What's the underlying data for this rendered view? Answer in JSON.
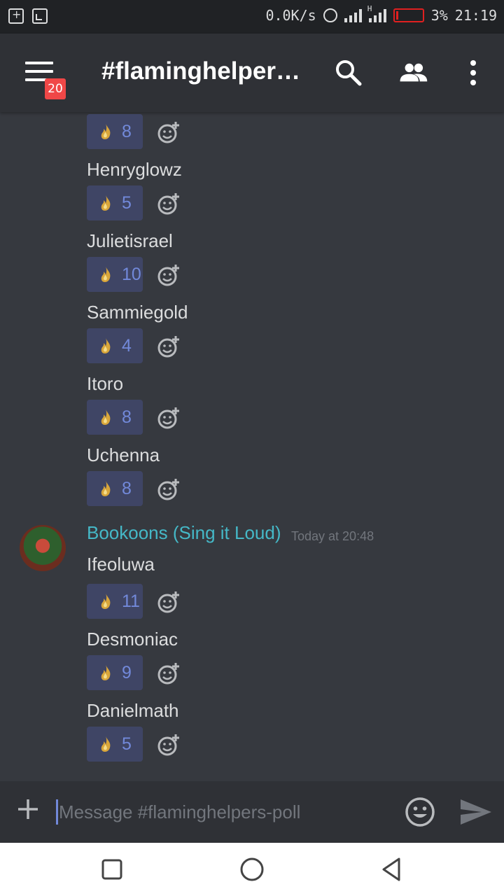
{
  "status_bar": {
    "net_speed": "0.0K/s",
    "signal_type": "H",
    "battery_percent": "3%",
    "time": "21:19",
    "battery_level": 0.03
  },
  "header": {
    "channel_title": "#flaminghelpers-...",
    "notification_count": "20"
  },
  "messages": {
    "top_entry": {
      "count": "8"
    },
    "entries_1": [
      {
        "name": "Henryglowz",
        "count": "5"
      },
      {
        "name": "Julietisrael",
        "count": "10"
      },
      {
        "name": "Sammiegold",
        "count": "4"
      },
      {
        "name": "Itoro",
        "count": "8"
      },
      {
        "name": "Uchenna",
        "count": "8"
      }
    ],
    "author": {
      "name": "Bookoons (Sing it Loud)",
      "timestamp": "Today at 20:48"
    },
    "entries_2": [
      {
        "name": "Ifeoluwa",
        "count": "11"
      },
      {
        "name": "Desmoniac",
        "count": "9"
      },
      {
        "name": "Danielmath",
        "count": "5"
      }
    ]
  },
  "composer": {
    "placeholder": "Message #flaminghelpers-poll"
  },
  "icons": {
    "reaction_emoji": "flame-icon",
    "add_reaction": "add-reaction-icon",
    "search": "search-icon",
    "members": "members-icon",
    "more": "more-vertical-icon",
    "emoji": "emoji-icon",
    "send": "send-icon",
    "plus": "plus-icon"
  },
  "colors": {
    "background": "#36393f",
    "header": "#2f3136",
    "reaction_bg": "#3f4565",
    "reaction_count": "#7289da",
    "author_name": "#45b8c7",
    "badge": "#f04747"
  }
}
